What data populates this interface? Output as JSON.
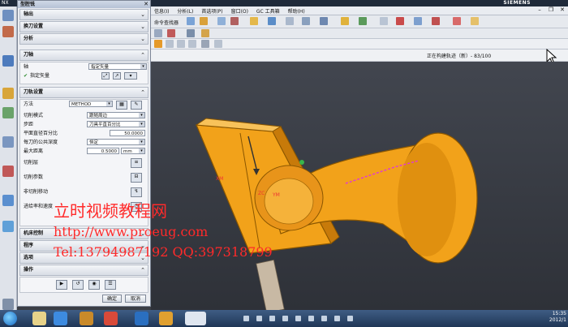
{
  "app": {
    "brand": "SIEMENS",
    "caption": "NX"
  },
  "menu": {
    "items": [
      "信息(I)",
      "分析(L)",
      "首选项(P)",
      "窗口(O)",
      "GC 工具箱",
      "帮助(H)"
    ]
  },
  "toolbar": {
    "selector_label": "命令查找器"
  },
  "status": {
    "progress_text": "正在构建轨迹（新）- 83/100"
  },
  "dialog": {
    "title": "型腔铣",
    "collapsed_top": [
      "轴出",
      "换刀设置",
      "分析"
    ],
    "tool_axis_section": "刀轴",
    "axis_label": "轴",
    "axis_value": "指定矢量",
    "specify_vector": "指定矢量",
    "path_section": "刀轨设置",
    "method_label": "方法",
    "method_value": "METHOD",
    "cut_mode_label": "切削模式",
    "cut_mode_value": "跟随周边",
    "stepover_label": "步距",
    "stepover_value": "刀具平直百分比",
    "flat_pct_label": "平面直径百分比",
    "flat_pct_value": "50.0000",
    "common_depth_label": "每刀的公共深度",
    "common_depth_value": "恒定",
    "max_dist_label": "最大距离",
    "max_dist_value": "0.5000",
    "max_dist_unit": "mm",
    "cut_layers": "切削层",
    "cut_params": "切削参数",
    "non_cut_moves": "非切削移动",
    "feeds_speeds": "进给率和速度",
    "machine_control": "机床控制",
    "program": "程序",
    "options": "选项",
    "actions": "操作",
    "ok": "确定",
    "cancel": "取消"
  },
  "overlay": {
    "line1": "立时视频教程网",
    "line2": "http://www.proeug.com",
    "line3": "Tel:13794987192  QQ:397318799"
  },
  "taskbar": {
    "time": "15:35",
    "date": "2012/1"
  },
  "colors": {
    "part": "#f2a21a",
    "part_dark": "#c77a0a",
    "overlay": "#ff2a2a",
    "bg": "#3a3d44"
  }
}
